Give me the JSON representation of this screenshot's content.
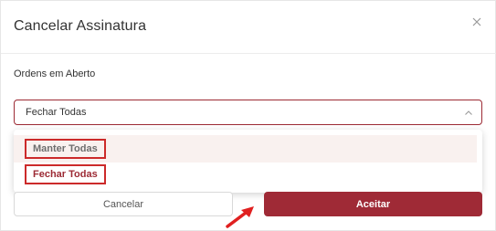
{
  "dialog": {
    "title": "Cancelar Assinatura",
    "close_icon": "close-icon"
  },
  "field": {
    "label": "Ordens em Aberto",
    "selected_value": "Fechar Todas",
    "chevron_icon": "chevron-up-icon"
  },
  "dropdown": {
    "options": [
      {
        "label": "Manter Todas"
      },
      {
        "label": "Fechar Todas"
      }
    ]
  },
  "buttons": {
    "cancel_label": "Cancelar",
    "accept_label": "Aceitar"
  },
  "annotation": {
    "arrow_icon": "pointer-arrow-icon",
    "arrow_color": "#e02020",
    "highlight_color": "#cc2a2a"
  },
  "colors": {
    "accent": "#9f2a36",
    "hover_bg": "#f9f1ef"
  }
}
